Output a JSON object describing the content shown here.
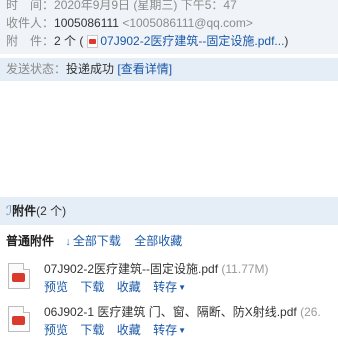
{
  "header": {
    "time_label": "时　间：",
    "time_value": "2020年9月9日 (星期三) 下午5：47",
    "to_label": "收件人：",
    "to_value": "1005086111",
    "to_email": "<1005086111@qq.com>",
    "att_label": "附　件：",
    "att_count": "2 个 (",
    "att_file": "07J902-2医疗建筑--固定设施.pdf...",
    "att_close": ")"
  },
  "status": {
    "label": "发送状态：",
    "value": "投递成功",
    "details_link": "[查看详情]"
  },
  "attachments": {
    "title": "附件",
    "count": "(2 个)",
    "section_label": "普通附件",
    "download_all": "全部下载",
    "collect_all": "全部收藏",
    "files": [
      {
        "name": "07J902-2医疗建筑--固定设施.pdf",
        "size": "(11.77M)",
        "actions": {
          "preview": "预览",
          "download": "下载",
          "collect": "收藏",
          "forward": "转存"
        }
      },
      {
        "name": "06J902-1 医疗建筑 门、窗、隔断、防X射线.pdf",
        "size": "(26.",
        "actions": {
          "preview": "预览",
          "download": "下载",
          "collect": "收藏",
          "forward": "转存"
        }
      }
    ]
  },
  "colors": {
    "link": "#1a58a8",
    "header_bg": "#f0f4f9",
    "bar_bg": "#e5edf6",
    "pdf_red": "#d93a2b"
  },
  "icons": [
    "pdf-icon",
    "paperclip-icon",
    "download-arrow-icon",
    "chevron-down-icon"
  ]
}
